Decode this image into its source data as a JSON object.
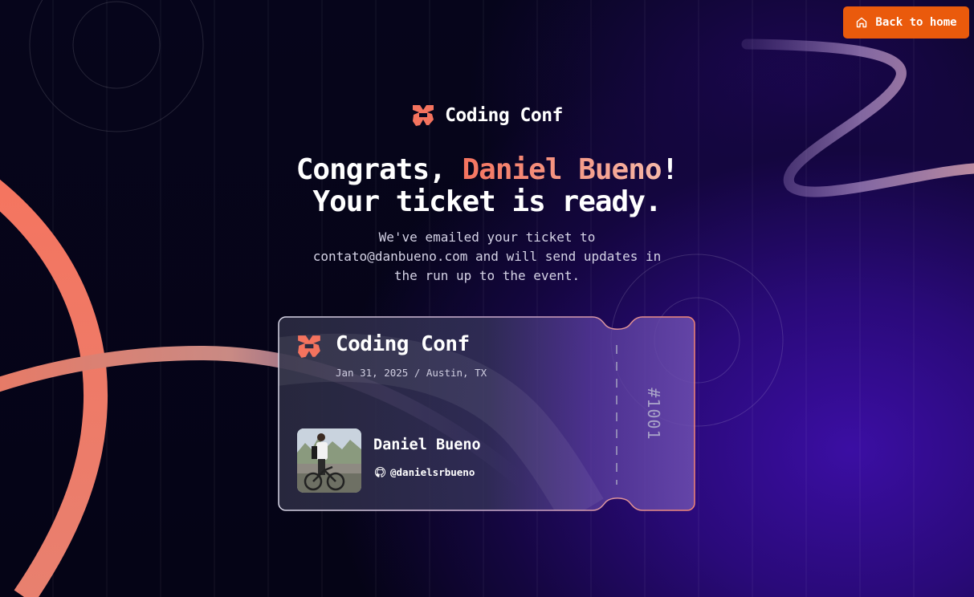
{
  "nav": {
    "back_home_label": "Back to home"
  },
  "brand": {
    "name": "Coding Conf"
  },
  "headline": {
    "prefix": "Congrats, ",
    "name": "Daniel Bueno",
    "suffix": "!",
    "line2": "Your ticket is ready."
  },
  "subtext": {
    "line1": "We've emailed your ticket to",
    "line2": "contato@danbueno.com and will send updates in",
    "line3": "the run up to the event."
  },
  "ticket": {
    "event_name": "Coding Conf",
    "date_location": "Jan 31, 2025 / Austin, TX",
    "attendee_name": "Daniel Bueno",
    "github_handle": "@danielsrbueno",
    "number": "#1001"
  },
  "colors": {
    "accent_orange": "#ea5a0c",
    "accent_coral": "#f4735e",
    "logo": "#f4735e"
  }
}
